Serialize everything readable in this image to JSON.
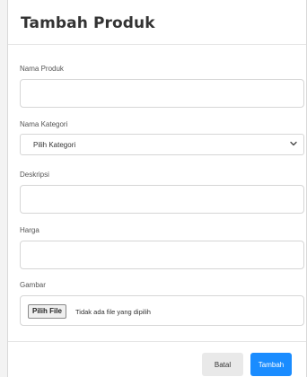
{
  "modal": {
    "title": "Tambah Produk"
  },
  "fields": {
    "nama_produk": {
      "label": "Nama Produk",
      "value": "",
      "placeholder": ""
    },
    "kategori": {
      "label": "Nama Kategori",
      "selected": "Pilih Kategori"
    },
    "deskripsi": {
      "label": "Deskripsi",
      "value": "",
      "placeholder": ""
    },
    "harga": {
      "label": "Harga",
      "value": "",
      "placeholder": ""
    },
    "gambar": {
      "label": "Gambar",
      "button_label": "Pilih File",
      "status": "Tidak ada file yang dipilih"
    }
  },
  "footer": {
    "cancel_label": "Batal",
    "submit_label": "Tambah"
  },
  "icons": {
    "select_arrow": "chevron-down-icon"
  },
  "colors": {
    "primary": "#1a8cff",
    "secondary": "#e9e9e9"
  }
}
